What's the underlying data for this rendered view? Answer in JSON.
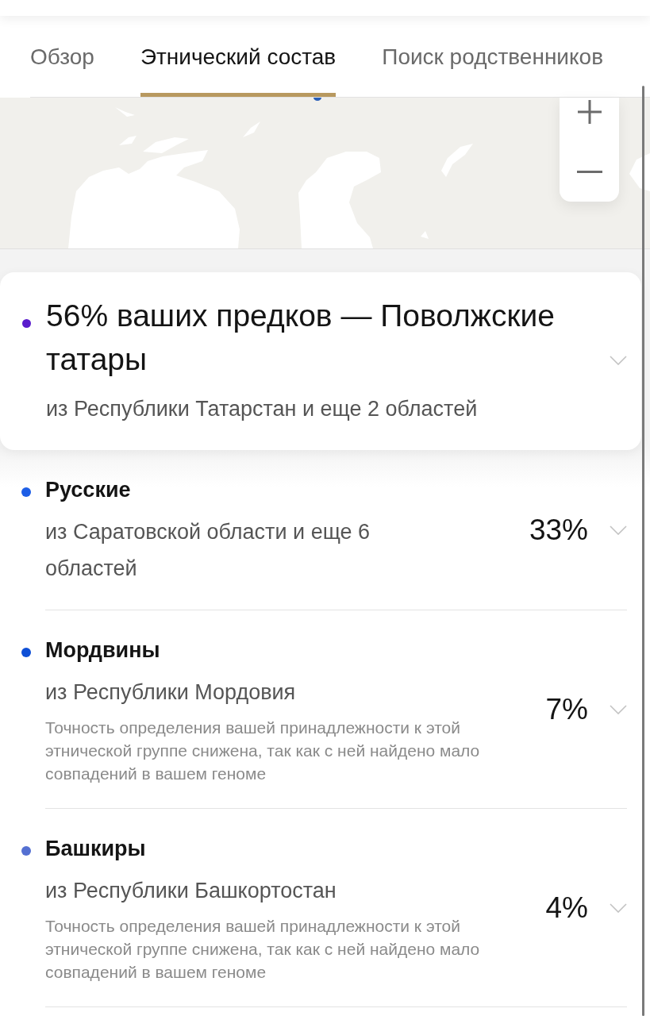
{
  "tabs": [
    {
      "label": "Обзор",
      "selected": false
    },
    {
      "label": "Этнический состав",
      "selected": true
    },
    {
      "label": "Поиск родственников",
      "selected": false
    }
  ],
  "main_group": {
    "title": "56% ваших предков — Поволжские татары",
    "origin": "из Республики Татарстан и еще 2 областей",
    "color": "#5a1ccc",
    "expanded": false
  },
  "groups": [
    {
      "name": "Русские",
      "origin": "из Саратовской области и еще 6 областей",
      "percent": "33%",
      "color": "#1d5ee6",
      "expanded": false
    },
    {
      "name": "Мордвины",
      "origin": "из Республики Мордовия",
      "note": "Точность определения вашей принадлежности к этой этнической группе снижена, так как с ней найдено мало совпадений в вашем геноме",
      "percent": "7%",
      "color": "#0e4fd6",
      "expanded": false
    },
    {
      "name": "Башкиры",
      "origin": "из Республики Башкортостан",
      "note": "Точность определения вашей принадлежности к этой этнической группе снижена, так как с ней найдено мало совпадений в вашем геноме",
      "percent": "4%",
      "color": "#5470d2",
      "expanded": false
    }
  ]
}
